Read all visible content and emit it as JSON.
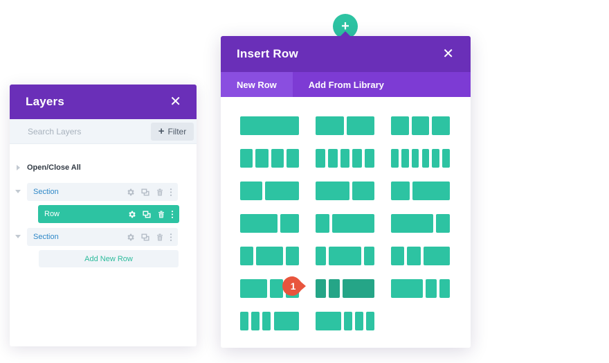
{
  "layers_panel": {
    "title": "Layers",
    "search_placeholder": "Search Layers",
    "filter_label": "Filter",
    "open_close_label": "Open/Close All",
    "items": [
      {
        "label": "Section",
        "type": "section"
      },
      {
        "label": "Row",
        "type": "row",
        "active": true
      },
      {
        "label": "Section",
        "type": "section"
      }
    ],
    "add_new_row_label": "Add New Row"
  },
  "insert_row_modal": {
    "title": "Insert Row",
    "tabs": [
      {
        "label": "New Row",
        "active": true
      },
      {
        "label": "Add From Library",
        "active": false
      }
    ],
    "layouts": [
      {
        "name": "1",
        "columns": [
          1
        ]
      },
      {
        "name": "1/2 1/2",
        "columns": [
          1,
          1
        ]
      },
      {
        "name": "1/3 1/3 1/3",
        "columns": [
          1,
          1,
          1
        ]
      },
      {
        "name": "1/4 1/4 1/4 1/4",
        "columns": [
          1,
          1,
          1,
          1
        ]
      },
      {
        "name": "1/5 x5",
        "columns": [
          1,
          1,
          1,
          1,
          1
        ]
      },
      {
        "name": "1/6 x6",
        "columns": [
          1,
          1,
          1,
          1,
          1,
          1
        ]
      },
      {
        "name": "2/5 3/5",
        "columns": [
          2,
          3
        ]
      },
      {
        "name": "3/5 2/5",
        "columns": [
          3,
          2
        ]
      },
      {
        "name": "1/3 2/3",
        "columns": [
          1,
          2
        ]
      },
      {
        "name": "2/3 1/3",
        "columns": [
          2,
          1
        ]
      },
      {
        "name": "1/4 3/4",
        "columns": [
          1,
          3
        ]
      },
      {
        "name": "3/4 1/4",
        "columns": [
          3,
          1
        ]
      },
      {
        "name": "1/4 1/2 1/4",
        "columns": [
          1,
          2,
          1
        ]
      },
      {
        "name": "1/5 3/5 1/5",
        "columns": [
          1,
          3,
          1
        ]
      },
      {
        "name": "1/4 1/4 1/2",
        "columns": [
          1,
          1,
          2
        ]
      },
      {
        "name": "1/2 1/4 1/4",
        "columns": [
          2,
          1,
          1
        ]
      },
      {
        "name": "1/5 1/5 3/5",
        "columns": [
          1,
          1,
          3
        ],
        "hovered": true
      },
      {
        "name": "3/5 1/5 1/5",
        "columns": [
          3,
          1,
          1
        ]
      },
      {
        "name": "1/6 1/6 1/6 1/2",
        "columns": [
          1,
          1,
          1,
          3
        ]
      },
      {
        "name": "1/2 1/6 1/6 1/6",
        "columns": [
          3,
          1,
          1,
          1
        ]
      }
    ]
  },
  "step_marker": {
    "number": "1",
    "color": "#e8553d"
  },
  "colors": {
    "purple_header": "#6a2fb8",
    "purple_tabs": "#7d3bd4",
    "teal": "#2dc3a2",
    "teal_dark": "#25a587",
    "link_blue": "#2e88c8"
  },
  "icons": [
    "close-icon",
    "plus-icon",
    "gear-icon",
    "duplicate-icon",
    "trash-icon",
    "more-vertical-icon"
  ]
}
